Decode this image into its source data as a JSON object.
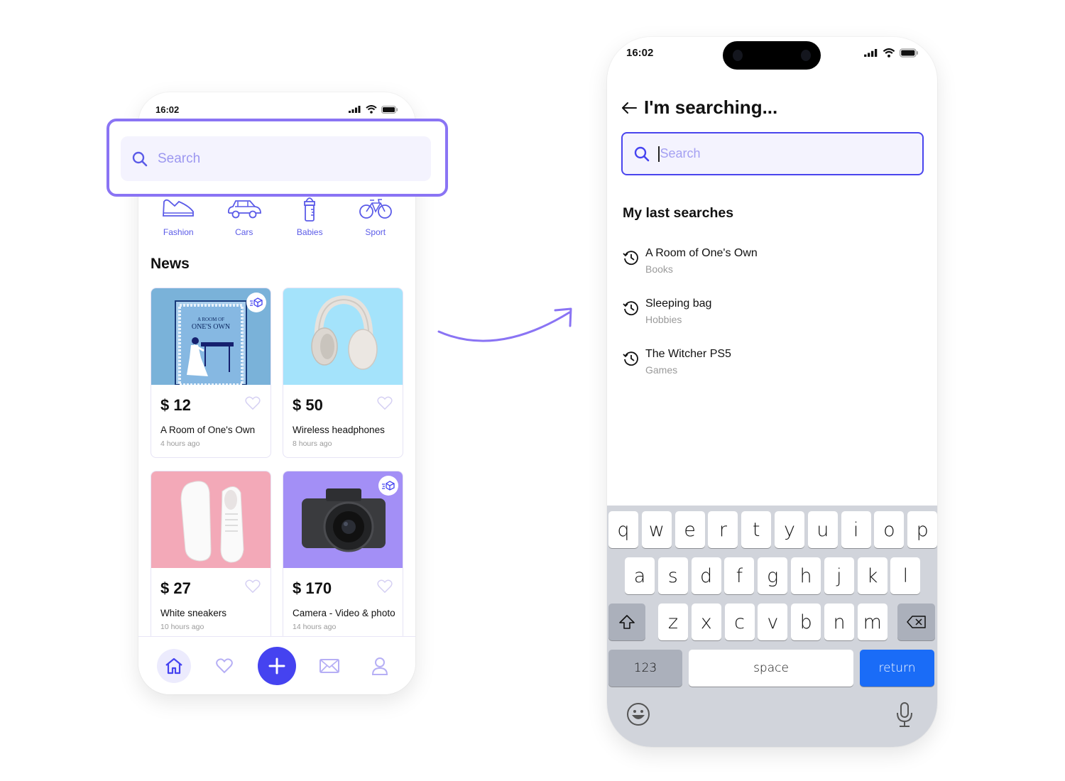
{
  "home_screen": {
    "status": {
      "time": "16:02"
    },
    "search": {
      "placeholder": "Search",
      "icon": "search-icon"
    },
    "categories": [
      {
        "label": "Fashion",
        "icon": "sneaker-icon"
      },
      {
        "label": "Cars",
        "icon": "car-icon"
      },
      {
        "label": "Babies",
        "icon": "baby-bottle-icon"
      },
      {
        "label": "Sport",
        "icon": "bicycle-icon"
      }
    ],
    "section_title": "News",
    "products": [
      {
        "price": "$ 12",
        "name": "A Room of One's Own",
        "posted": "4 hours ago",
        "image_bg": "#7ab2d9",
        "delivery_badge": true
      },
      {
        "price": "$ 50",
        "name": "Wireless headphones",
        "posted": "8 hours ago",
        "image_bg": "#a4e3fb",
        "delivery_badge": false
      },
      {
        "price": "$ 27",
        "name": "White sneakers",
        "posted": "10 hours ago",
        "image_bg": "#f3a9b8",
        "delivery_badge": false
      },
      {
        "price": "$ 170",
        "name": "Camera - Video & photo",
        "posted": "14 hours ago",
        "image_bg": "#a38ff6",
        "delivery_badge": true
      }
    ],
    "book_cover": {
      "line1": "A ROOM OF",
      "line2": "ONE'S OWN"
    },
    "bottom_nav": [
      {
        "name": "home",
        "icon": "home-icon",
        "active": true
      },
      {
        "name": "favorites",
        "icon": "heart-icon",
        "active": false
      },
      {
        "name": "add",
        "icon": "plus-icon",
        "active": false
      },
      {
        "name": "messages",
        "icon": "mail-icon",
        "active": false
      },
      {
        "name": "profile",
        "icon": "user-icon",
        "active": false
      }
    ]
  },
  "search_screen": {
    "status": {
      "time": "16:02"
    },
    "title": "I'm searching...",
    "search": {
      "placeholder": "Search",
      "value": ""
    },
    "recent_title": "My last searches",
    "recent_searches": [
      {
        "query": "A Room of One's Own",
        "category": "Books"
      },
      {
        "query": "Sleeping bag",
        "category": "Hobbies"
      },
      {
        "query": "The Witcher PS5",
        "category": "Games"
      }
    ],
    "keyboard": {
      "row1": [
        "q",
        "w",
        "e",
        "r",
        "t",
        "y",
        "u",
        "i",
        "o",
        "p"
      ],
      "row2": [
        "a",
        "s",
        "d",
        "f",
        "g",
        "h",
        "j",
        "k",
        "l"
      ],
      "row3": [
        "z",
        "x",
        "c",
        "v",
        "b",
        "n",
        "m"
      ],
      "numbers_label": "123",
      "space_label": "space",
      "return_label": "return"
    }
  },
  "colors": {
    "accent": "#4543f0",
    "highlight": "#8a74f4",
    "category_text": "#5b5be8",
    "search_bg": "#f4f3fe",
    "return_key": "#1a6cf7",
    "keyboard_bg": "#d1d4db"
  }
}
